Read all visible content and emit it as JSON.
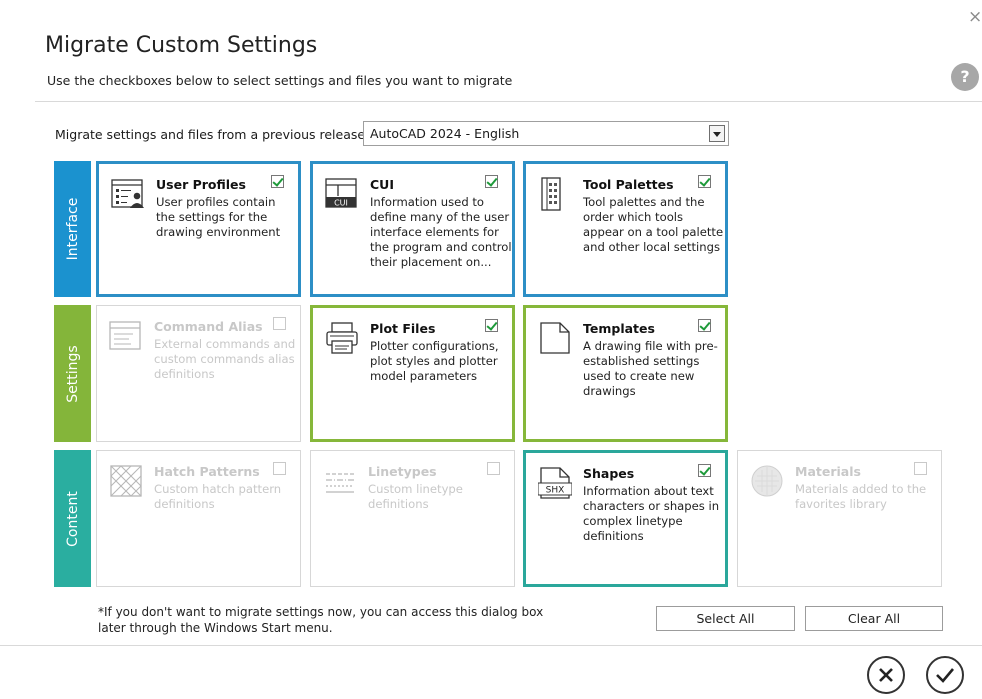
{
  "dialog": {
    "close_glyph": "×",
    "title": "Migrate Custom Settings",
    "subtitle": "Use the checkboxes below to select settings and files you want to migrate",
    "help_glyph": "?"
  },
  "release": {
    "label": "Migrate settings and files from a previous release:",
    "value": "AutoCAD 2024 - English"
  },
  "bands": {
    "interface": "Interface",
    "settings": "Settings",
    "content": "Content"
  },
  "colors": {
    "interface": "#1b92cf",
    "settings": "#84b53a",
    "content": "#2aaea0"
  },
  "tiles": {
    "user_profiles": {
      "title": "User Profiles",
      "desc": "User profiles contain the settings for the drawing environment",
      "checked": true,
      "icon": "user-profile-icon"
    },
    "cui": {
      "title": "CUI",
      "desc": "Information used to define many of the user interface elements for the program and control their placement on...",
      "checked": true,
      "icon": "cui-icon",
      "icon_text": "CUI"
    },
    "tool_palettes": {
      "title": "Tool Palettes",
      "desc": "Tool palettes and the order which tools appear on a tool palette and other local settings",
      "checked": true,
      "icon": "tool-palette-icon"
    },
    "command_alias": {
      "title": "Command Alias",
      "desc": "External commands and custom commands alias definitions",
      "checked": false,
      "icon": "command-alias-icon"
    },
    "plot_files": {
      "title": "Plot Files",
      "desc": "Plotter configurations, plot styles and plotter model parameters",
      "checked": true,
      "icon": "plotter-icon"
    },
    "templates": {
      "title": "Templates",
      "desc": "A drawing file with pre-established settings used to create new drawings",
      "checked": true,
      "icon": "template-icon"
    },
    "hatch_patterns": {
      "title": "Hatch Patterns",
      "desc": "Custom hatch pattern definitions",
      "checked": false,
      "icon": "hatch-pattern-icon"
    },
    "linetypes": {
      "title": "Linetypes",
      "desc": "Custom linetype definitions",
      "checked": false,
      "icon": "linetype-icon"
    },
    "shapes": {
      "title": "Shapes",
      "desc": "Information about text characters or shapes in complex linetype definitions",
      "checked": true,
      "icon": "shx-icon",
      "icon_text": "SHX"
    },
    "materials": {
      "title": "Materials",
      "desc": "Materials added to the favorites library",
      "checked": false,
      "icon": "materials-icon"
    }
  },
  "footer": {
    "note_line1": "*If you don't want to migrate settings now, you can access this dialog box",
    "note_line2": "later through the Windows Start menu.",
    "select_all": "Select All",
    "clear_all": "Clear All",
    "cancel_glyph": "✕",
    "ok_glyph": "✓"
  }
}
